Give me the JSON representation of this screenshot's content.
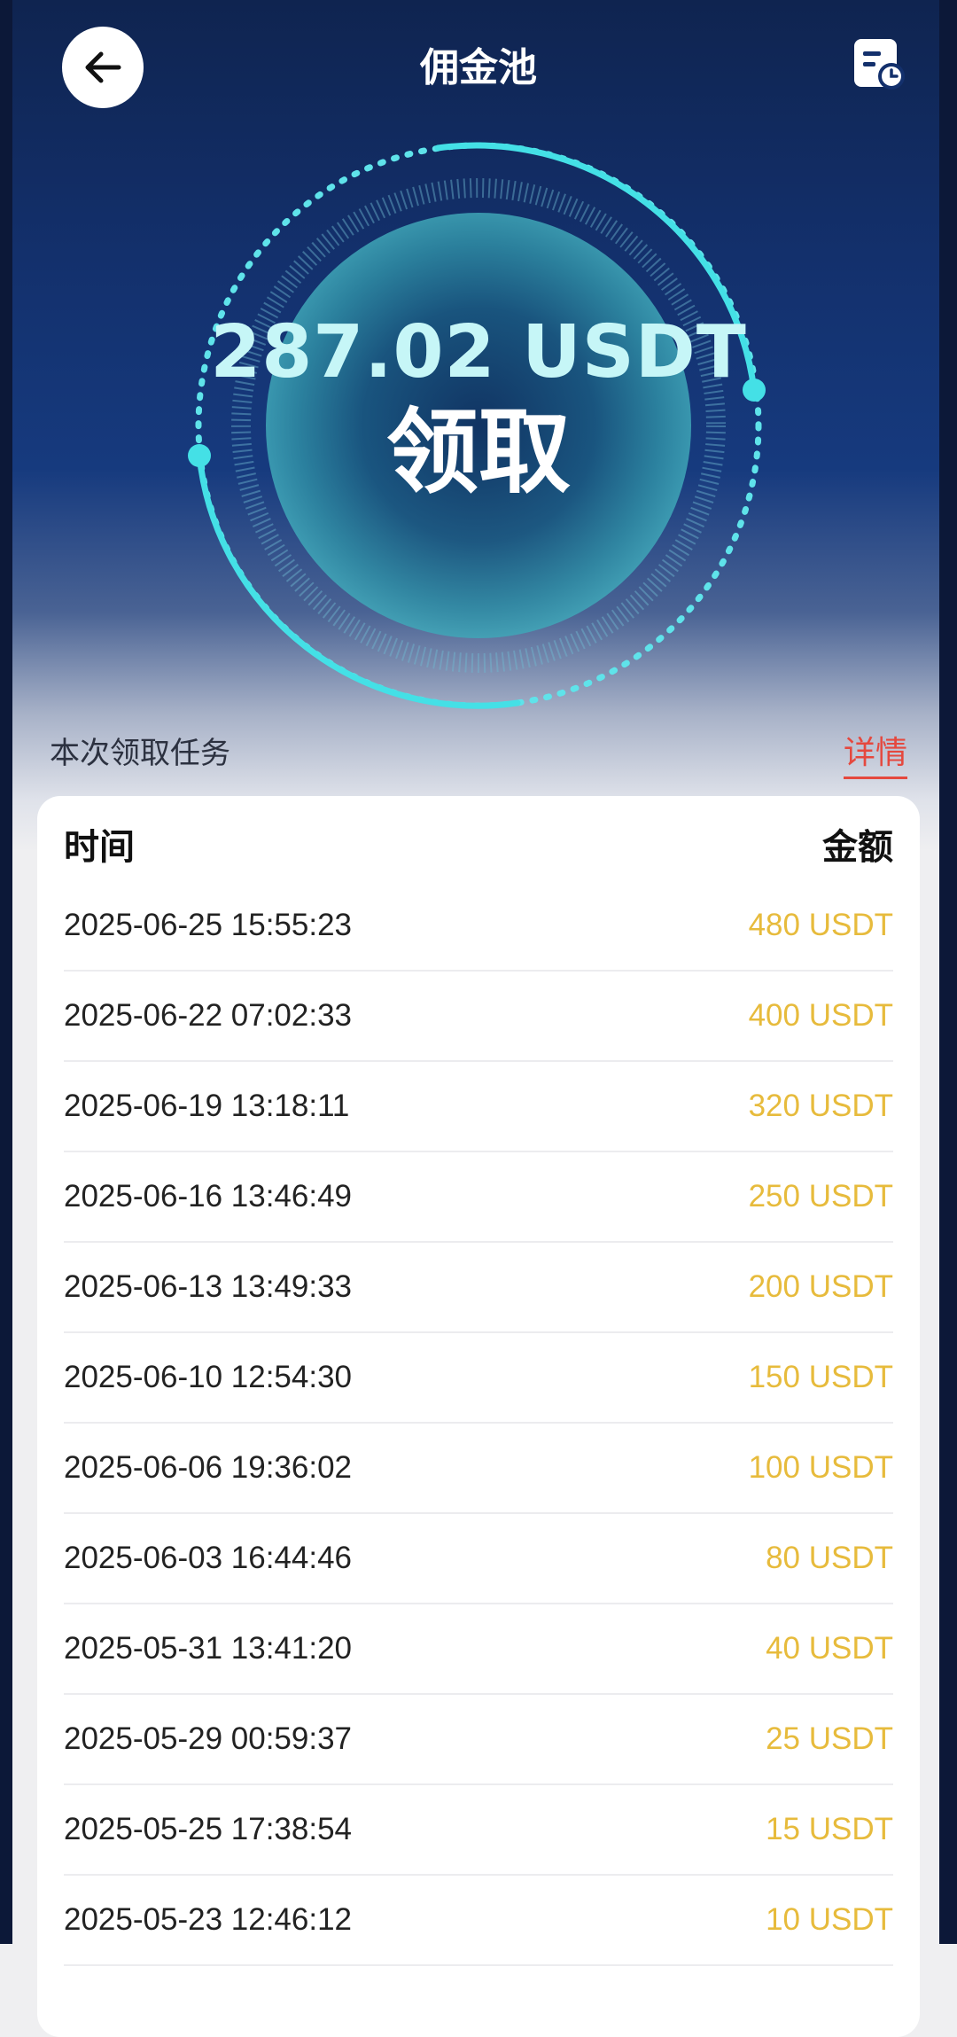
{
  "header": {
    "title": "佣金池",
    "back_icon": "arrow-left-icon",
    "history_icon": "record-clock-icon"
  },
  "pool": {
    "amount": "287.02 USDT",
    "claim_label": "领取"
  },
  "task": {
    "label": "本次领取任务",
    "details_label": "详情"
  },
  "table": {
    "columns": [
      "时间",
      "金额"
    ],
    "rows": [
      {
        "time": "2025-06-25 15:55:23",
        "amount": "480 USDT"
      },
      {
        "time": "2025-06-22 07:02:33",
        "amount": "400 USDT"
      },
      {
        "time": "2025-06-19 13:18:11",
        "amount": "320 USDT"
      },
      {
        "time": "2025-06-16 13:46:49",
        "amount": "250 USDT"
      },
      {
        "time": "2025-06-13 13:49:33",
        "amount": "200 USDT"
      },
      {
        "time": "2025-06-10 12:54:30",
        "amount": "150 USDT"
      },
      {
        "time": "2025-06-06 19:36:02",
        "amount": "100 USDT"
      },
      {
        "time": "2025-06-03 16:44:46",
        "amount": "80 USDT"
      },
      {
        "time": "2025-05-31 13:41:20",
        "amount": "40 USDT"
      },
      {
        "time": "2025-05-29 00:59:37",
        "amount": "25 USDT"
      },
      {
        "time": "2025-05-25 17:38:54",
        "amount": "15 USDT"
      },
      {
        "time": "2025-05-23 12:46:12",
        "amount": "10 USDT"
      }
    ]
  },
  "colors": {
    "accent_cyan": "#44e0e6",
    "amount_gold": "#e7bb3c",
    "details_red": "#e5483e"
  }
}
